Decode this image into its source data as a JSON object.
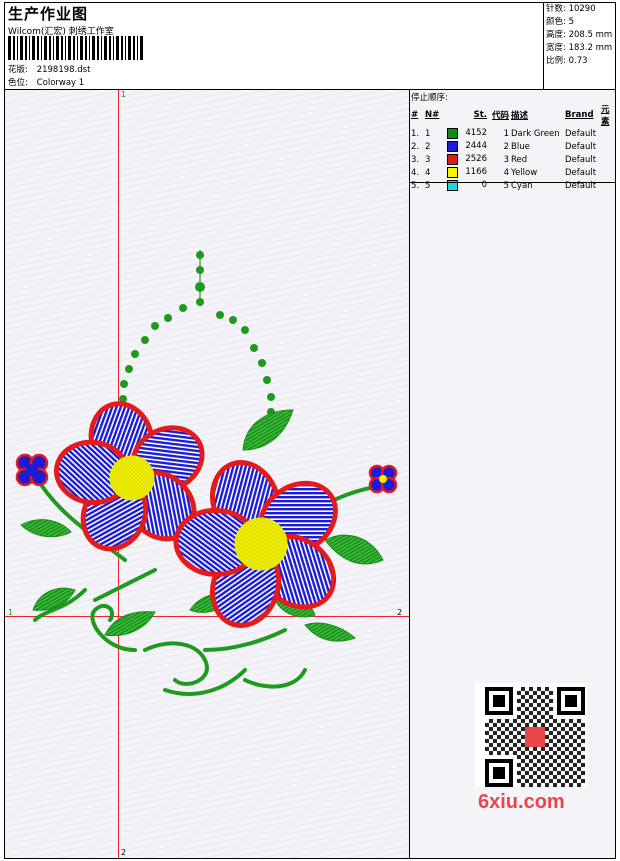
{
  "header": {
    "title": "生产作业图",
    "subtitle": "Wilcom(汇宏) 刺绣工作室",
    "design_label": "花版:",
    "design_value": "2198198.dst",
    "colorway_label": "色位:",
    "colorway_value": "Colorway 1"
  },
  "stats": [
    {
      "label": "针数:",
      "value": "10290"
    },
    {
      "label": "颜色:",
      "value": "5"
    },
    {
      "label": "高度:",
      "value": "208.5 mm"
    },
    {
      "label": "宽度:",
      "value": "183.2 mm"
    },
    {
      "label": "比例:",
      "value": "0.73"
    }
  ],
  "axes": {
    "top": "1",
    "left": "1",
    "right": "2",
    "bottom": "2"
  },
  "stop_panel": {
    "title": "停止顺序:",
    "columns": [
      "#",
      "N#",
      "St.",
      "代码",
      "描述",
      "Brand",
      "元素"
    ],
    "rows": [
      {
        "idx": "1.",
        "n": "1",
        "color": "#118a11",
        "st": "4152",
        "code": "1",
        "desc": "Dark Green",
        "brand": "Default"
      },
      {
        "idx": "2.",
        "n": "2",
        "color": "#1a1ad8",
        "st": "2444",
        "code": "2",
        "desc": "Blue",
        "brand": "Default"
      },
      {
        "idx": "3.",
        "n": "3",
        "color": "#e01818",
        "st": "2526",
        "code": "3",
        "desc": "Red",
        "brand": "Default"
      },
      {
        "idx": "4.",
        "n": "4",
        "color": "#f5f500",
        "st": "1166",
        "code": "4",
        "desc": "Yellow",
        "brand": "Default"
      },
      {
        "idx": "5.",
        "n": "5",
        "color": "#18d8e0",
        "st": "0",
        "code": "5",
        "desc": "Cyan",
        "brand": "Default"
      }
    ]
  },
  "watermark": {
    "text": "6xiu.com"
  },
  "colors": {
    "green": "#1f9a1f",
    "blue": "#1c1cd6",
    "red": "#e51b1b",
    "yellow": "#f2f200",
    "axis": "#e22233"
  }
}
